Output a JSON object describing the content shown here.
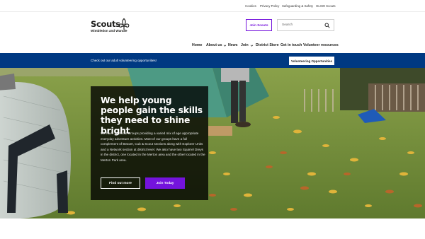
{
  "utility_links": [
    "Cookies",
    "Privacy Policy",
    "Safeguarding & Safety",
    "GLSW Scouts"
  ],
  "brand": {
    "name": "Scouts",
    "subtitle": "Wimbledon and Wandle"
  },
  "header": {
    "join_label": "Join Scouts",
    "search_placeholder": "Search"
  },
  "nav": {
    "items": [
      {
        "label": "Home",
        "dropdown": false
      },
      {
        "label": "About us",
        "dropdown": true
      },
      {
        "label": "News",
        "dropdown": false
      },
      {
        "label": "Join",
        "dropdown": true
      },
      {
        "label": "District Store",
        "dropdown": false
      },
      {
        "label": "Get in touch",
        "dropdown": false
      },
      {
        "label": "Volunteer resources",
        "dropdown": false
      }
    ]
  },
  "banner": {
    "text": "Check out our adult volunteering opportunities!",
    "button": "Volunteering Opportunities"
  },
  "hero": {
    "title": "We help young people gain the skills they need to shine bright",
    "body": "We have 16 Scout Groups providing a varied mix of age appropriate everyday adventure activities. Most of our groups have a full complement of Beaver, Cub & Scout sections along with Explorer Units and a Network section at district level. We also have two Squirrel Dreys in the district, one located in the Merton area and the other located in the Merton Park area.",
    "primary_button": "Find out more",
    "secondary_button": "Join Today"
  },
  "colors": {
    "purple": "#7413dc",
    "navy": "#003982",
    "panel": "#000000"
  },
  "icons": {
    "search": "search-icon",
    "dropdown": "chevron-down-icon",
    "logo": "fleur-de-lis-icon"
  }
}
